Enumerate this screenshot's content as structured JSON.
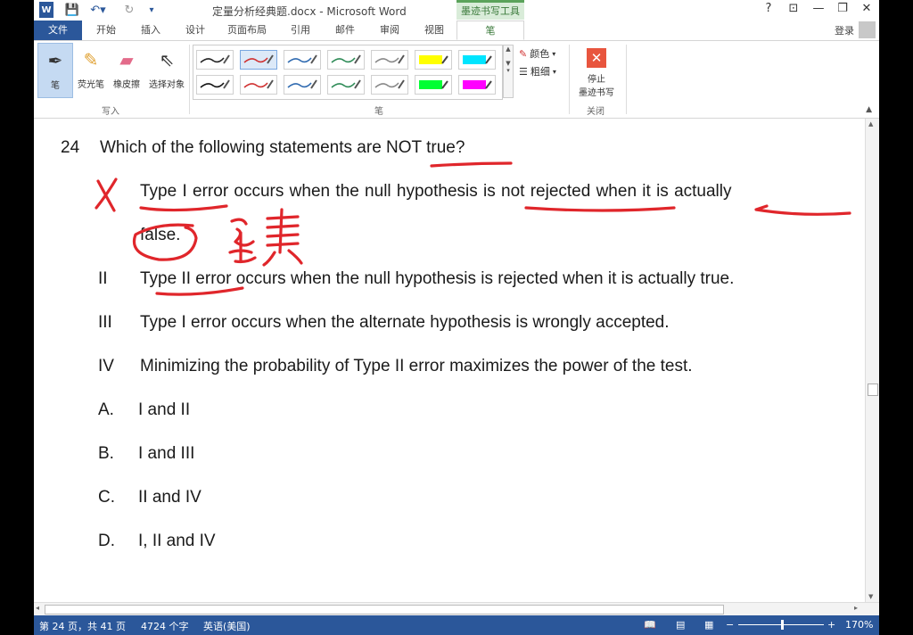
{
  "titlebar": {
    "title": "定量分析经典题.docx - Microsoft Word",
    "tool_tab_title": "墨迹书写工具",
    "help": "?",
    "controls": [
      "⊡",
      "—",
      "❐",
      "✕"
    ]
  },
  "tabs": [
    {
      "label": "文件"
    },
    {
      "label": "开始"
    },
    {
      "label": "插入"
    },
    {
      "label": "设计"
    },
    {
      "label": "页面布局"
    },
    {
      "label": "引用"
    },
    {
      "label": "邮件"
    },
    {
      "label": "审阅"
    },
    {
      "label": "视图"
    },
    {
      "label": "笔"
    }
  ],
  "login": "登录",
  "ribbon": {
    "write_tools": [
      {
        "label": "笔",
        "icon": "pen-icon"
      },
      {
        "label": "荧光笔",
        "icon": "highlighter-icon"
      },
      {
        "label": "橡皮擦",
        "icon": "eraser-icon"
      },
      {
        "label": "选择对象",
        "icon": "cursor-icon"
      }
    ],
    "group_write": "写入",
    "group_pen": "笔",
    "group_close": "关闭",
    "color_label": "颜色",
    "weight_label": "粗细",
    "stop_label_1": "停止",
    "stop_label_2": "墨迹书写",
    "pens": [
      {
        "color": "#222222",
        "type": "line"
      },
      {
        "color": "#d03030",
        "type": "line"
      },
      {
        "color": "#2f6ab0",
        "type": "line"
      },
      {
        "color": "#2e8b57",
        "type": "line"
      },
      {
        "color": "#888888",
        "type": "line"
      },
      {
        "color": "#ffff00",
        "type": "hl"
      },
      {
        "color": "#00e5ff",
        "type": "hl"
      },
      {
        "color": "#111111",
        "type": "line"
      },
      {
        "color": "#d03030",
        "type": "line"
      },
      {
        "color": "#2f6ab0",
        "type": "line"
      },
      {
        "color": "#2e8b57",
        "type": "line"
      },
      {
        "color": "#888888",
        "type": "line"
      },
      {
        "color": "#00ff33",
        "type": "hl"
      },
      {
        "color": "#ff00ff",
        "type": "hl"
      }
    ]
  },
  "doc": {
    "question_number": "24",
    "question": "Which of the following statements are NOT true?",
    "stmt1": "Type I error occurs when the null hypothesis is not rejected when it is actually",
    "stmt1_cont": "false.",
    "stmt2_label": "II",
    "stmt2": "Type II error occurs when the null hypothesis is rejected when it is actually true.",
    "stmt3_label": "III",
    "stmt3": "Type I error occurs when the alternate hypothesis is wrongly accepted.",
    "stmt4_label": "IV",
    "stmt4": "Minimizing the probability of Type II error maximizes the power of the test.",
    "options": [
      {
        "label": "A.",
        "text": "I and II"
      },
      {
        "label": "B.",
        "text": "I and III"
      },
      {
        "label": "C.",
        "text": "II and IV"
      },
      {
        "label": "D.",
        "text": "I, II and IV"
      }
    ]
  },
  "statusbar": {
    "page": "第 24 页，共 41 页",
    "words": "4724 个字",
    "language": "英语(美国)",
    "zoom": "170%"
  }
}
